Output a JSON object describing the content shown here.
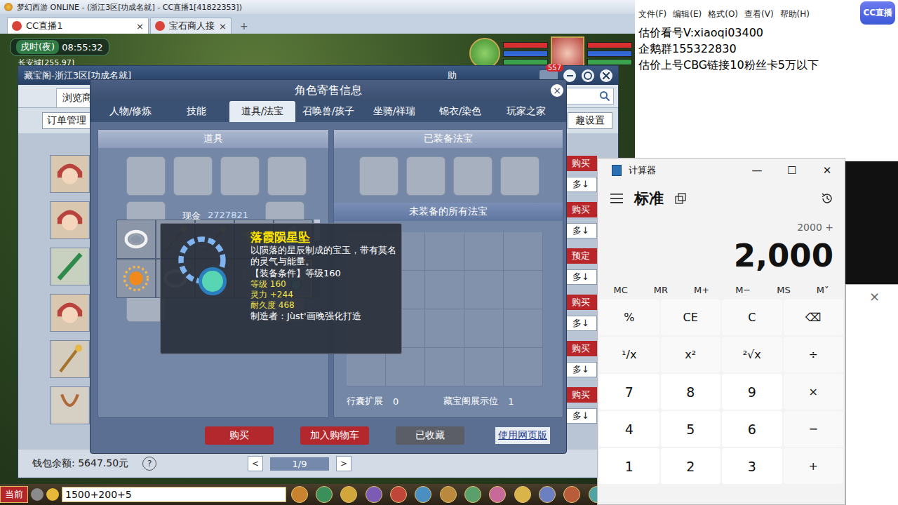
{
  "app": {
    "title": "梦幻西游 ONLINE - (浙江3区[功成名就] - CC直播1[41822353])"
  },
  "browser_tabs": [
    {
      "label": "CC直播1",
      "close": "×",
      "selected": true
    },
    {
      "label": "宝石商人接",
      "close": "×",
      "selected": false
    }
  ],
  "new_tab": "+",
  "hud": {
    "period": "戌时(夜)",
    "clock": "08:55:32",
    "location": "长安城[255,97]"
  },
  "cbg": {
    "title": "藏宝阁-浙江3区[功成名就]",
    "help": "助",
    "badge": "557",
    "browse_tab": "浏览商",
    "orders_button": "订单管理",
    "settings_button": "趣设置",
    "rows": [
      {
        "avatar": "character",
        "action": "购买",
        "more": "多↓"
      },
      {
        "avatar": "character",
        "action": "购买",
        "more": "多↓"
      },
      {
        "avatar": "weapon",
        "action": "预定",
        "more": "多↓"
      },
      {
        "avatar": "character",
        "action": "购买",
        "more": "多↓"
      },
      {
        "avatar": "staff",
        "action": "购买",
        "more": "多↓"
      },
      {
        "avatar": "ornament",
        "action": "购买",
        "more": "多↓"
      }
    ],
    "wallet": "钱包余额: 5647.50元",
    "wallet_help": "?",
    "prev": "<",
    "page": "1/9",
    "next": ">"
  },
  "dialog": {
    "title": "角色寄售信息",
    "close": "×",
    "tabs": [
      {
        "label": "人物/修炼",
        "selected": false
      },
      {
        "label": "技能",
        "selected": false
      },
      {
        "label": "道具/法宝",
        "selected": true
      },
      {
        "label": "召唤兽/孩子",
        "selected": false
      },
      {
        "label": "坐骑/祥瑞",
        "selected": false
      },
      {
        "label": "锦衣/染色",
        "selected": false
      },
      {
        "label": "玩家之家",
        "selected": false
      }
    ],
    "items_header": "道具",
    "cash_label": "现金",
    "cash": "2727821",
    "items": [
      {
        "kind": "ring",
        "selected": false
      },
      {
        "kind": "staff",
        "selected": false
      },
      {
        "kind": "staff",
        "selected": false
      },
      {
        "kind": "fan",
        "selected": false
      },
      {
        "kind": "gem",
        "selected": false
      },
      {
        "kind": "sun",
        "selected": false
      },
      {
        "kind": "ring",
        "selected": false
      },
      {
        "kind": "pendant",
        "selected": false
      },
      {
        "kind": "pendant",
        "selected": false
      },
      {
        "kind": "pendant",
        "selected": true
      }
    ],
    "equipped_header": "已装备法宝",
    "unequipped_header": "未装备的所有法宝",
    "bag_label": "行囊扩展",
    "bag": "0",
    "showcase_label": "藏宝阁展示位",
    "showcase": "1",
    "buttons": [
      {
        "label": "购买",
        "kind": "red"
      },
      {
        "label": "加入购物车",
        "kind": "red"
      },
      {
        "label": "已收藏",
        "kind": "grey"
      }
    ],
    "web_link": "使用网页版"
  },
  "tooltip": {
    "name": "落霞陨星坠",
    "description": "以陨落的星辰制成的宝玉，带有莫名的灵气与能量。",
    "requirement": "【装备条件】等级160",
    "stats": [
      "等级 160",
      "灵力 +244",
      "耐久度 468"
    ],
    "maker": "制造者：Jùst'画晚强化打造"
  },
  "chat": {
    "channel": "当前",
    "input": "1500+200+5"
  },
  "notepad": {
    "menu": [
      "文件(F)",
      "编辑(E)",
      "格式(O)",
      "查看(V)",
      "帮助(H)"
    ],
    "lines": [
      "估价看号V:xiaoqi03400",
      "企鹅群155322830",
      "估价上号CBG链接10粉丝卡5万以下"
    ]
  },
  "logo": "CC直播",
  "calculator": {
    "title": "计算器",
    "controls": [
      "—",
      "☐",
      "✕"
    ],
    "mode": "标准",
    "history": "2000 +",
    "display": "2,000",
    "memory": [
      "MC",
      "MR",
      "M+",
      "M−",
      "MS",
      "M˅"
    ],
    "keys": [
      {
        "label": "%",
        "kind": "op"
      },
      {
        "label": "CE",
        "kind": "op"
      },
      {
        "label": "C",
        "kind": "op"
      },
      {
        "label": "⌫",
        "kind": "op"
      },
      {
        "label": "¹/x",
        "kind": "op"
      },
      {
        "label": "x²",
        "kind": "op"
      },
      {
        "label": "²√x",
        "kind": "op"
      },
      {
        "label": "÷",
        "kind": "op"
      },
      {
        "label": "7",
        "kind": "digit"
      },
      {
        "label": "8",
        "kind": "digit"
      },
      {
        "label": "9",
        "kind": "digit"
      },
      {
        "label": "×",
        "kind": "op"
      },
      {
        "label": "4",
        "kind": "digit"
      },
      {
        "label": "5",
        "kind": "digit"
      },
      {
        "label": "6",
        "kind": "digit"
      },
      {
        "label": "−",
        "kind": "op"
      },
      {
        "label": "1",
        "kind": "digit"
      },
      {
        "label": "2",
        "kind": "digit"
      },
      {
        "label": "3",
        "kind": "digit"
      },
      {
        "label": "+",
        "kind": "op"
      }
    ]
  },
  "back_window": {
    "close": "×"
  }
}
